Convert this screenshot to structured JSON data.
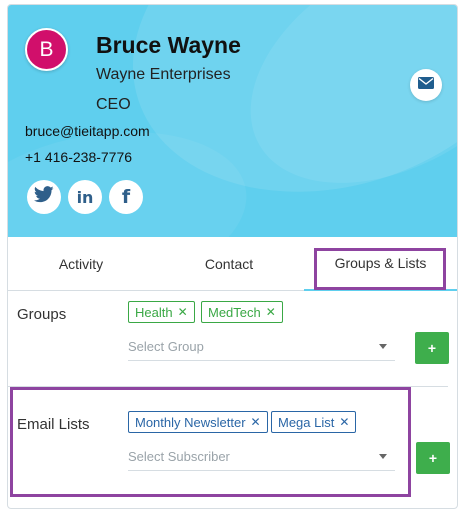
{
  "contact": {
    "initial": "B",
    "name": "Bruce Wayne",
    "company": "Wayne Enterprises",
    "title": "CEO",
    "email": "bruce@tieitapp.com",
    "phone": "+1 416-238-7776"
  },
  "social": {
    "twitter_icon": "twitter-icon",
    "linkedin_label": "in",
    "facebook_label": "f"
  },
  "tabs": [
    {
      "label": "Activity"
    },
    {
      "label": "Contact"
    },
    {
      "label": "Groups & Lists",
      "active": true
    }
  ],
  "groups": {
    "label": "Groups",
    "tags": [
      "Health",
      "MedTech"
    ],
    "placeholder": "Select Group",
    "add_label": "+"
  },
  "email_lists": {
    "label": "Email Lists",
    "tags": [
      "Monthly Newsletter",
      "Mega List"
    ],
    "placeholder": "Select Subscriber",
    "add_label": "+"
  },
  "tag_remove_glyph": "✕",
  "colors": {
    "header_bg": "#5fcfee",
    "avatar_bg": "#d10f6b",
    "group_tag": "#3aa845",
    "list_tag": "#2a66a6",
    "add_button": "#3eae4c",
    "highlight": "#8e44a0"
  }
}
